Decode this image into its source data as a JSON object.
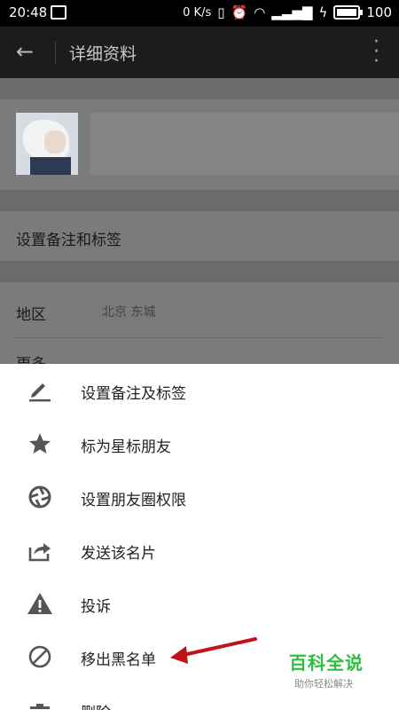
{
  "statusbar": {
    "time": "20:48",
    "speed": "0 K/s",
    "battery": "100"
  },
  "appbar": {
    "title": "详细资料",
    "back_icon": "arrow-left-icon",
    "more_icon": "more-vert-icon"
  },
  "profile": {
    "remark_label": "设置备注和标签",
    "region_label": "地区",
    "region_value": "北京  东城",
    "more_label": "更多"
  },
  "menu": [
    {
      "label": "设置备注及标签",
      "icon": "pencil-icon"
    },
    {
      "label": "标为星标朋友",
      "icon": "star-icon"
    },
    {
      "label": "设置朋友圈权限",
      "icon": "aperture-icon"
    },
    {
      "label": "发送该名片",
      "icon": "share-icon"
    },
    {
      "label": "投诉",
      "icon": "warning-icon"
    },
    {
      "label": "移出黑名单",
      "icon": "block-icon"
    },
    {
      "label": "删除",
      "icon": "trash-icon"
    }
  ],
  "watermark": {
    "title": "百科全说",
    "subtitle": "助你轻松解决"
  },
  "colors": {
    "accent": "#c0121b",
    "watermark": "#2fbe44",
    "icon": "#555555"
  }
}
